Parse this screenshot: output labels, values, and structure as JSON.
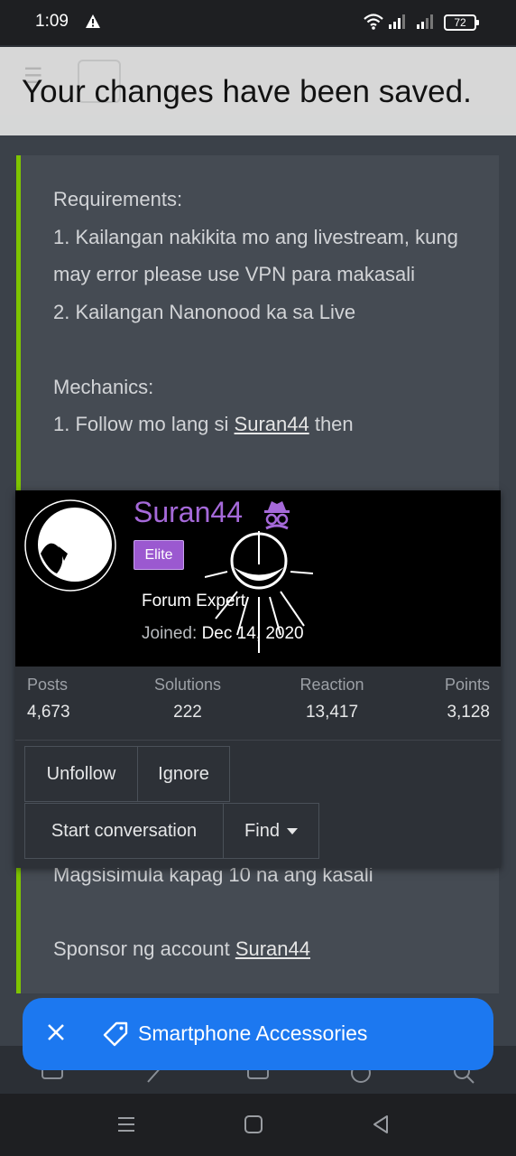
{
  "status_bar": {
    "time": "1:09",
    "battery": "72",
    "warning_icon": "warning-triangle-icon",
    "wifi_icon": "wifi-icon",
    "signal_icon": "signal-bars-icon"
  },
  "toast": {
    "message": "Your changes have been saved."
  },
  "post": {
    "accent_color": "#7ec400",
    "lines": [
      "Requirements:",
      "1. Kailangan nakikita mo ang livestream, kung may error please use VPN para makasali",
      "2. Kailangan Nanonood ka sa Live",
      "",
      "Mechanics:"
    ],
    "mechanics_prefix": "1. Follow mo lang si ",
    "mechanics_link": "Suran44",
    "mechanics_suffix": " then",
    "start_line": "Magsisimula kapag 10 na ang kasali",
    "sponsor_prefix": "Sponsor ng account ",
    "sponsor_link": "Suran44"
  },
  "member_card": {
    "username": "Suran44",
    "username_color": "#a569d9",
    "role_icon": "incognito-icon",
    "badge": "Elite",
    "title": "Forum Expert",
    "joined_label": "Joined:",
    "joined_date": "Dec 14, 2020",
    "stats": [
      {
        "label": "Posts",
        "value": "4,673"
      },
      {
        "label": "Solutions",
        "value": "222"
      },
      {
        "label": "Reaction",
        "value": "13,417"
      },
      {
        "label": "Points",
        "value": "3,128"
      }
    ],
    "buttons": {
      "unfollow": "Unfollow",
      "ignore": "Ignore",
      "start_conversation": "Start conversation",
      "find": "Find"
    }
  },
  "floating_bar": {
    "label": "Smartphone Accessories",
    "color": "#1c78f0",
    "close_icon": "close-icon",
    "tag_icon": "tag-icon"
  },
  "system_nav": {
    "menu_icon": "menu-icon",
    "home_icon": "home-icon",
    "back_icon": "back-icon"
  }
}
